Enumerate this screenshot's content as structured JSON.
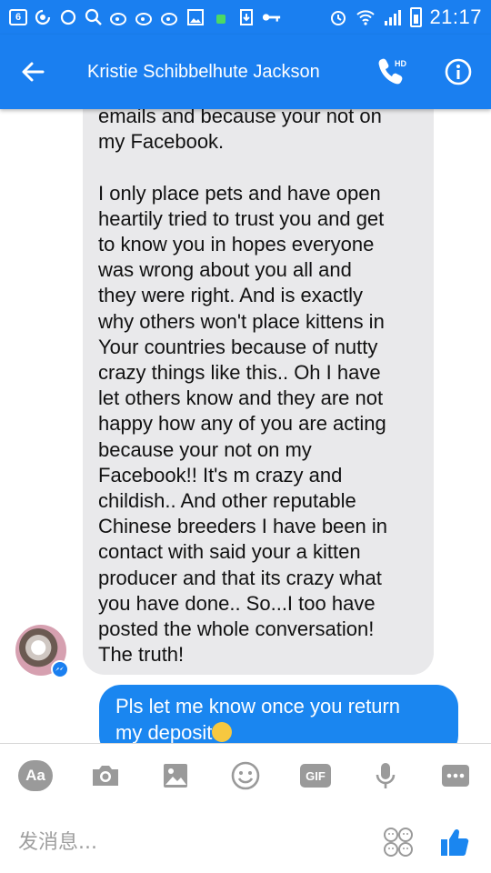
{
  "status_bar": {
    "notification_count": "6",
    "time": "21:17",
    "icons": [
      "notification-count-icon",
      "weibo-icon",
      "messenger-icon",
      "search-icon",
      "weibo-icon",
      "weibo-icon",
      "gallery-icon",
      "android-icon",
      "download-icon",
      "key-icon",
      "alarm-icon",
      "wifi-icon",
      "signal-icon",
      "battery-icon"
    ]
  },
  "header": {
    "contact_name": "Kristie Schibbelhute Jackson",
    "back_icon": "arrow-left-icon",
    "call_icon": "hd-phone-icon",
    "call_badge": "HD",
    "info_icon": "info-icon"
  },
  "messages": {
    "incoming_text": "emails and because your not on\nmy Facebook.\n\nI only place pets and have open\nheartily tried to trust you and get\nto know you in hopes everyone\nwas wrong about you all and\nthey were right. And is exactly\nwhy others won't place kittens in\nYour countries because of nutty\ncrazy things like this.. Oh I have\nlet others know and they are not\nhappy how any of you are acting\nbecause your not on my\nFacebook!! It's m crazy and\nchildish.. And other reputable\nChinese breeders I have been in\ncontact with said your a kitten\nproducer and that its crazy what\nyou have done.. So...I too have\nposted the whole conversation!\nThe truth!",
    "outgoing_text": "Pls let me know once you return\nmy deposit",
    "outgoing_emoji": "grinning-emoji"
  },
  "composer": {
    "aa_label": "Aa",
    "gif_label": "GIF",
    "placeholder": "发消息...",
    "tools": [
      "text-style-icon",
      "camera-icon",
      "image-icon",
      "emoji-icon",
      "gif-icon",
      "microphone-icon",
      "more-icon"
    ],
    "sticker_icon": "sticker-faces-icon",
    "like_icon": "thumbs-up-icon"
  },
  "colors": {
    "brand": "#1a7ff0",
    "incoming_bubble": "#e9e9eb",
    "outgoing_bubble": "#1a86f0",
    "tool_gray": "#9a9a9a"
  }
}
